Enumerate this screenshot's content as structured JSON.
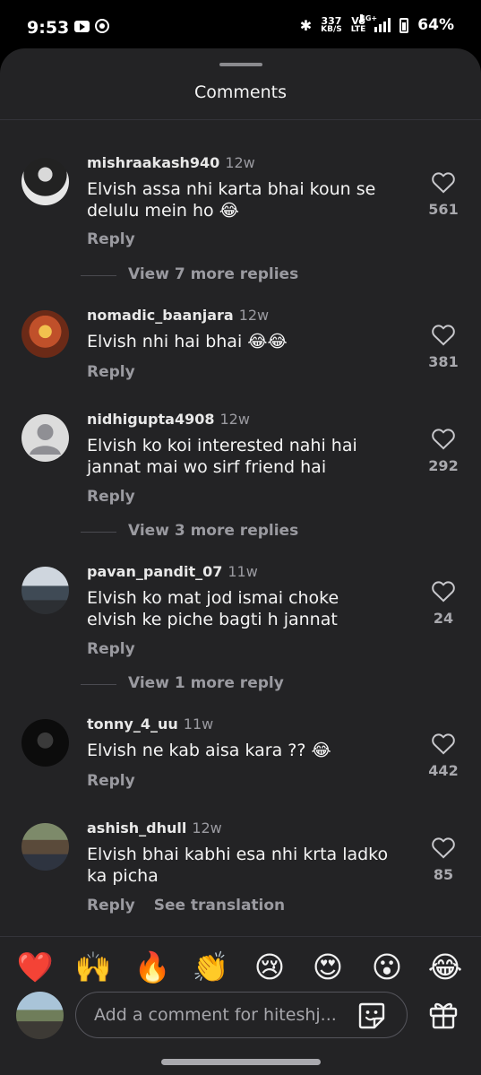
{
  "status": {
    "time": "9:53",
    "net_speed_value": "337",
    "net_speed_unit": "KB/S",
    "volte_top": "Vo",
    "volte_bottom": "LTE",
    "network": "4G+",
    "battery": "64%",
    "icons": [
      "youtube-icon",
      "app-circle-icon",
      "bluetooth-icon",
      "signal-icon",
      "battery-icon"
    ]
  },
  "sheet": {
    "title": "Comments"
  },
  "comments": [
    {
      "username": "mishraakash940",
      "time": "12w",
      "text": "Elvish assa nhi karta bhai koun se delulu mein ho 😂",
      "reply": "Reply",
      "likes": "561",
      "view_replies": "View 7 more replies"
    },
    {
      "username": "nomadic_baanjara",
      "time": "12w",
      "text": "Elvish nhi hai bhai 😂😂",
      "reply": "Reply",
      "likes": "381"
    },
    {
      "username": "nidhigupta4908",
      "time": "12w",
      "text": "Elvish ko koi interested nahi hai jannat mai wo sirf friend hai",
      "reply": "Reply",
      "likes": "292",
      "view_replies": "View 3 more replies"
    },
    {
      "username": "pavan_pandit_07",
      "time": "11w",
      "text": "Elvish ko mat jod ismai choke elvish ke piche bagti h jannat",
      "reply": "Reply",
      "likes": "24",
      "view_replies": "View 1 more reply"
    },
    {
      "username": "tonny_4_uu",
      "time": "11w",
      "text": "Elvish ne kab aisa kara ?? 😂",
      "reply": "Reply",
      "likes": "442"
    },
    {
      "username": "ashish_dhull",
      "time": "12w",
      "text": "Elvish bhai kabhi esa nhi krta ladko ka picha",
      "reply": "Reply",
      "see_translation": "See translation",
      "likes": "85"
    }
  ],
  "emoji_bar": [
    "❤️",
    "🙌",
    "🔥",
    "👏",
    "😢",
    "😍",
    "😮",
    "😂"
  ],
  "composer": {
    "placeholder": "Add a comment for hiteshj...",
    "sticker_icon": "sticker-icon",
    "gift_icon": "gift-icon"
  },
  "colors": {
    "sheet_bg": "#232325",
    "text": "#f4f4f4",
    "muted": "#9a9aa0"
  }
}
